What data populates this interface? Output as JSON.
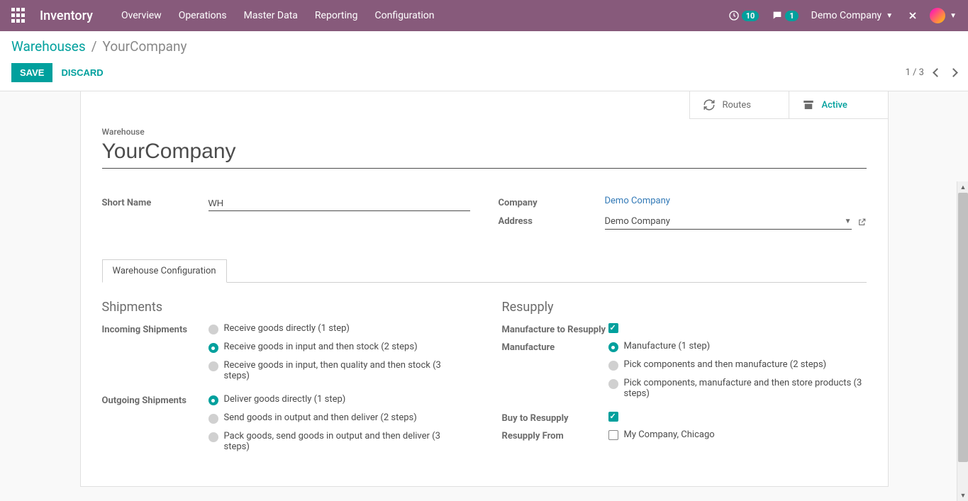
{
  "navbar": {
    "brand": "Inventory",
    "menu": [
      "Overview",
      "Operations",
      "Master Data",
      "Reporting",
      "Configuration"
    ],
    "notif_count": "10",
    "chat_count": "1",
    "company": "Demo Company"
  },
  "breadcrumb": {
    "parent": "Warehouses",
    "current": "YourCompany"
  },
  "buttons": {
    "save": "SAVE",
    "discard": "DISCARD"
  },
  "pager": {
    "text": "1 / 3"
  },
  "stat": {
    "routes": "Routes",
    "active": "Active"
  },
  "form": {
    "warehouse_label": "Warehouse",
    "name": "YourCompany",
    "short_name_label": "Short Name",
    "short_name": "WH",
    "company_label": "Company",
    "company_value": "Demo Company",
    "address_label": "Address",
    "address_value": "Demo Company"
  },
  "tabs": {
    "config": "Warehouse Configuration"
  },
  "shipments": {
    "title": "Shipments",
    "incoming_label": "Incoming Shipments",
    "incoming": [
      {
        "label": "Receive goods directly (1 step)",
        "checked": false
      },
      {
        "label": "Receive goods in input and then stock (2 steps)",
        "checked": true
      },
      {
        "label": "Receive goods in input, then quality and then stock (3 steps)",
        "checked": false
      }
    ],
    "outgoing_label": "Outgoing Shipments",
    "outgoing": [
      {
        "label": "Deliver goods directly (1 step)",
        "checked": true
      },
      {
        "label": "Send goods in output and then deliver (2 steps)",
        "checked": false
      },
      {
        "label": "Pack goods, send goods in output and then deliver (3 steps)",
        "checked": false
      }
    ]
  },
  "resupply": {
    "title": "Resupply",
    "mfg_resupply_label": "Manufacture to Resupply",
    "mfg_resupply_checked": true,
    "manufacture_label": "Manufacture",
    "manufacture": [
      {
        "label": "Manufacture (1 step)",
        "checked": true
      },
      {
        "label": "Pick components and then manufacture (2 steps)",
        "checked": false
      },
      {
        "label": "Pick components, manufacture and then store products (3 steps)",
        "checked": false
      }
    ],
    "buy_label": "Buy to Resupply",
    "buy_checked": true,
    "resupply_from_label": "Resupply From",
    "resupply_from_option": "My Company, Chicago",
    "resupply_from_checked": false
  }
}
